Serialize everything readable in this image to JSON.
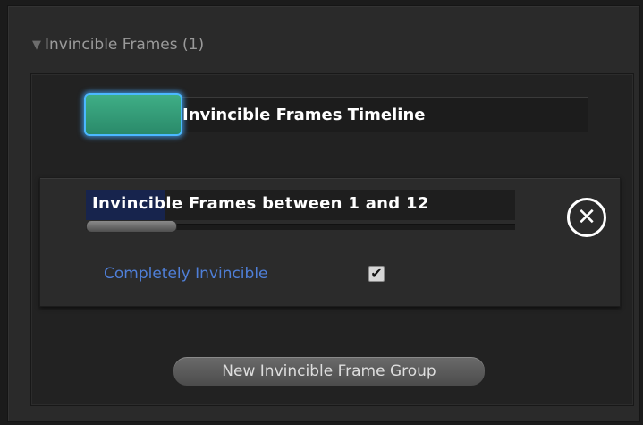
{
  "foldout": {
    "arrow_icon": "triangle-down-icon",
    "label": "Invincible Frames (1)"
  },
  "timeline": {
    "label": "Invincible Frames Timeline",
    "handle_color": "#3fae86",
    "focus_color": "#4bb8ff"
  },
  "frame_group": {
    "range_label": "Invincible Frames between 1 and 12",
    "remove_icon": "close-circle-icon",
    "remove_symbol": "✕",
    "completely_invincible_label": "Completely Invincible",
    "completely_invincible_checked": true,
    "check_symbol": "✔",
    "label_color": "#4f7fd8"
  },
  "new_group_button": {
    "label": "New Invincible Frame Group"
  }
}
